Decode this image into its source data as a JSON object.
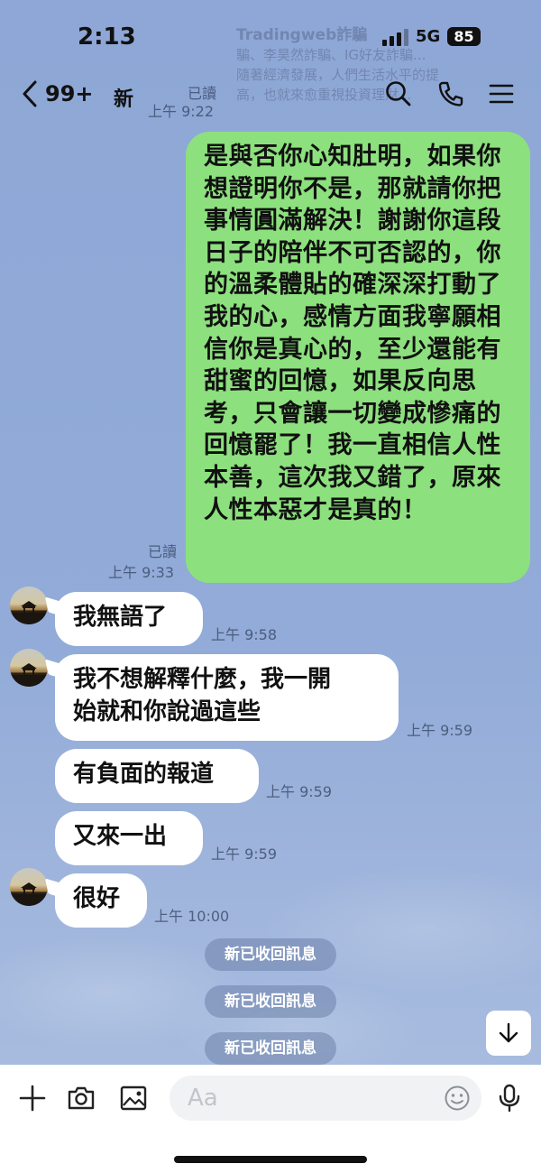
{
  "status_bar": {
    "time": "2:13",
    "network": "5G",
    "battery": "85"
  },
  "ghost_banner": {
    "title": "Tradingweb詐騙",
    "lines": [
      "騙、李昊然詐騙、IG好友詐騙...",
      "隨著經濟發展，人們生活水平的提",
      "高，也就來愈重視投資理財..."
    ]
  },
  "header": {
    "back_count": "99+",
    "title": "新",
    "hidden_read": "已讀",
    "hidden_time": "上午 9:22",
    "icons": [
      "search-icon",
      "phone-icon",
      "menu-icon"
    ]
  },
  "messages": {
    "outgoing": {
      "text": "是與否你心知肚明，如果你想證明你不是，那就請你把事情圓滿解決！謝謝你這段日子的陪伴不可否認的，你的溫柔體貼的確深深打動了我的心，感情方面我寧願相信你是真心的，至少還能有甜蜜的回憶，如果反向思考，只會讓一切變成慘痛的回憶罷了！我一直相信人性本善，這次我又錯了，原來人性本惡才是真的！",
      "read": "已讀",
      "time": "上午 9:33"
    },
    "incoming": [
      {
        "text": "我無語了",
        "time": "上午 9:58"
      },
      {
        "text_line1": "我不想解釋什麼，我一開",
        "text_line2": "始就和你說過這些",
        "time": "上午 9:59"
      },
      {
        "text": "有負面的報道",
        "time": "上午 9:59"
      },
      {
        "text": "又來一出",
        "time": "上午 9:59"
      },
      {
        "text": "很好",
        "time": "上午 10:00"
      }
    ],
    "recalled": [
      "新已收回訊息",
      "新已收回訊息",
      "新已收回訊息"
    ]
  },
  "input_bar": {
    "placeholder": "Aa",
    "icons": [
      "plus-icon",
      "camera-icon",
      "image-icon",
      "emoji-icon",
      "microphone-icon"
    ]
  },
  "colors": {
    "outgoing_bubble": "#8de07e",
    "incoming_bubble": "#ffffff",
    "background": "#92abd8",
    "recalled_pill": "#7e91b8"
  }
}
